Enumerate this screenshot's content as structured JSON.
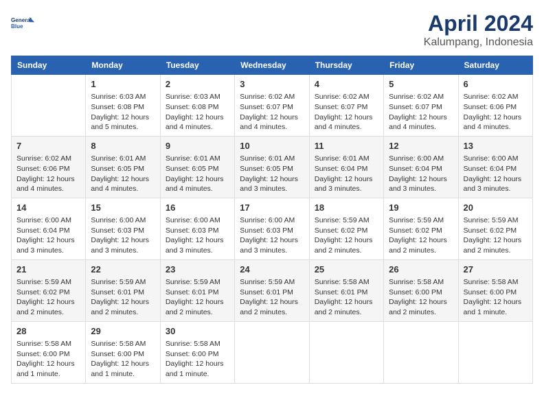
{
  "header": {
    "logo_line1": "General",
    "logo_line2": "Blue",
    "title": "April 2024",
    "subtitle": "Kalumpang, Indonesia"
  },
  "calendar": {
    "days_of_week": [
      "Sunday",
      "Monday",
      "Tuesday",
      "Wednesday",
      "Thursday",
      "Friday",
      "Saturday"
    ],
    "weeks": [
      [
        {
          "day": "",
          "info": ""
        },
        {
          "day": "1",
          "info": "Sunrise: 6:03 AM\nSunset: 6:08 PM\nDaylight: 12 hours\nand 5 minutes."
        },
        {
          "day": "2",
          "info": "Sunrise: 6:03 AM\nSunset: 6:08 PM\nDaylight: 12 hours\nand 4 minutes."
        },
        {
          "day": "3",
          "info": "Sunrise: 6:02 AM\nSunset: 6:07 PM\nDaylight: 12 hours\nand 4 minutes."
        },
        {
          "day": "4",
          "info": "Sunrise: 6:02 AM\nSunset: 6:07 PM\nDaylight: 12 hours\nand 4 minutes."
        },
        {
          "day": "5",
          "info": "Sunrise: 6:02 AM\nSunset: 6:07 PM\nDaylight: 12 hours\nand 4 minutes."
        },
        {
          "day": "6",
          "info": "Sunrise: 6:02 AM\nSunset: 6:06 PM\nDaylight: 12 hours\nand 4 minutes."
        }
      ],
      [
        {
          "day": "7",
          "info": "Sunrise: 6:02 AM\nSunset: 6:06 PM\nDaylight: 12 hours\nand 4 minutes."
        },
        {
          "day": "8",
          "info": "Sunrise: 6:01 AM\nSunset: 6:05 PM\nDaylight: 12 hours\nand 4 minutes."
        },
        {
          "day": "9",
          "info": "Sunrise: 6:01 AM\nSunset: 6:05 PM\nDaylight: 12 hours\nand 4 minutes."
        },
        {
          "day": "10",
          "info": "Sunrise: 6:01 AM\nSunset: 6:05 PM\nDaylight: 12 hours\nand 3 minutes."
        },
        {
          "day": "11",
          "info": "Sunrise: 6:01 AM\nSunset: 6:04 PM\nDaylight: 12 hours\nand 3 minutes."
        },
        {
          "day": "12",
          "info": "Sunrise: 6:00 AM\nSunset: 6:04 PM\nDaylight: 12 hours\nand 3 minutes."
        },
        {
          "day": "13",
          "info": "Sunrise: 6:00 AM\nSunset: 6:04 PM\nDaylight: 12 hours\nand 3 minutes."
        }
      ],
      [
        {
          "day": "14",
          "info": "Sunrise: 6:00 AM\nSunset: 6:04 PM\nDaylight: 12 hours\nand 3 minutes."
        },
        {
          "day": "15",
          "info": "Sunrise: 6:00 AM\nSunset: 6:03 PM\nDaylight: 12 hours\nand 3 minutes."
        },
        {
          "day": "16",
          "info": "Sunrise: 6:00 AM\nSunset: 6:03 PM\nDaylight: 12 hours\nand 3 minutes."
        },
        {
          "day": "17",
          "info": "Sunrise: 6:00 AM\nSunset: 6:03 PM\nDaylight: 12 hours\nand 3 minutes."
        },
        {
          "day": "18",
          "info": "Sunrise: 5:59 AM\nSunset: 6:02 PM\nDaylight: 12 hours\nand 2 minutes."
        },
        {
          "day": "19",
          "info": "Sunrise: 5:59 AM\nSunset: 6:02 PM\nDaylight: 12 hours\nand 2 minutes."
        },
        {
          "day": "20",
          "info": "Sunrise: 5:59 AM\nSunset: 6:02 PM\nDaylight: 12 hours\nand 2 minutes."
        }
      ],
      [
        {
          "day": "21",
          "info": "Sunrise: 5:59 AM\nSunset: 6:02 PM\nDaylight: 12 hours\nand 2 minutes."
        },
        {
          "day": "22",
          "info": "Sunrise: 5:59 AM\nSunset: 6:01 PM\nDaylight: 12 hours\nand 2 minutes."
        },
        {
          "day": "23",
          "info": "Sunrise: 5:59 AM\nSunset: 6:01 PM\nDaylight: 12 hours\nand 2 minutes."
        },
        {
          "day": "24",
          "info": "Sunrise: 5:59 AM\nSunset: 6:01 PM\nDaylight: 12 hours\nand 2 minutes."
        },
        {
          "day": "25",
          "info": "Sunrise: 5:58 AM\nSunset: 6:01 PM\nDaylight: 12 hours\nand 2 minutes."
        },
        {
          "day": "26",
          "info": "Sunrise: 5:58 AM\nSunset: 6:00 PM\nDaylight: 12 hours\nand 2 minutes."
        },
        {
          "day": "27",
          "info": "Sunrise: 5:58 AM\nSunset: 6:00 PM\nDaylight: 12 hours\nand 1 minute."
        }
      ],
      [
        {
          "day": "28",
          "info": "Sunrise: 5:58 AM\nSunset: 6:00 PM\nDaylight: 12 hours\nand 1 minute."
        },
        {
          "day": "29",
          "info": "Sunrise: 5:58 AM\nSunset: 6:00 PM\nDaylight: 12 hours\nand 1 minute."
        },
        {
          "day": "30",
          "info": "Sunrise: 5:58 AM\nSunset: 6:00 PM\nDaylight: 12 hours\nand 1 minute."
        },
        {
          "day": "",
          "info": ""
        },
        {
          "day": "",
          "info": ""
        },
        {
          "day": "",
          "info": ""
        },
        {
          "day": "",
          "info": ""
        }
      ]
    ]
  }
}
